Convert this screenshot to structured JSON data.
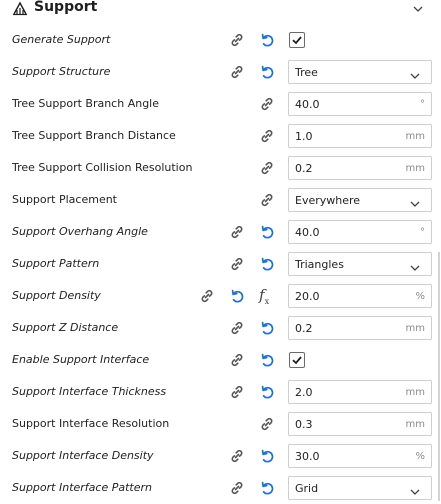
{
  "section": {
    "title": "Support",
    "icon": "support-section-icon",
    "collapse_icon": "chevron-down-icon"
  },
  "settings": [
    {
      "id": "generate-support",
      "label": "Generate Support",
      "italic": true,
      "link": "a",
      "reset": true,
      "control": "checkbox",
      "checked": true
    },
    {
      "id": "support-structure",
      "label": "Support Structure",
      "italic": true,
      "link": "a",
      "reset": true,
      "control": "select",
      "value": "Tree"
    },
    {
      "id": "tree-support-branch-angle",
      "label": "Tree Support Branch Angle",
      "italic": false,
      "link": "b",
      "reset": false,
      "control": "number",
      "value": "40.0",
      "unit": "°"
    },
    {
      "id": "tree-support-branch-distance",
      "label": "Tree Support Branch Distance",
      "italic": false,
      "link": "b",
      "reset": false,
      "control": "number",
      "value": "1.0",
      "unit": "mm"
    },
    {
      "id": "tree-support-collision-resolution",
      "label": "Tree Support Collision Resolution",
      "italic": false,
      "link": "b",
      "reset": false,
      "control": "number",
      "value": "0.2",
      "unit": "mm"
    },
    {
      "id": "support-placement",
      "label": "Support Placement",
      "italic": false,
      "link": "b",
      "reset": false,
      "control": "select",
      "value": "Everywhere"
    },
    {
      "id": "support-overhang-angle",
      "label": "Support Overhang Angle",
      "italic": true,
      "link": "a",
      "reset": true,
      "control": "number",
      "value": "40.0",
      "unit": "°"
    },
    {
      "id": "support-pattern",
      "label": "Support Pattern",
      "italic": true,
      "link": "a",
      "reset": true,
      "control": "select",
      "value": "Triangles"
    },
    {
      "id": "support-density",
      "label": "Support Density",
      "italic": true,
      "link": "c",
      "reset": true,
      "fx": true,
      "control": "number",
      "value": "20.0",
      "unit": "%"
    },
    {
      "id": "support-z-distance",
      "label": "Support Z Distance",
      "italic": true,
      "link": "a",
      "reset": true,
      "control": "number",
      "value": "0.2",
      "unit": "mm"
    },
    {
      "id": "enable-support-interface",
      "label": "Enable Support Interface",
      "italic": true,
      "link": "a",
      "reset": true,
      "control": "checkbox",
      "checked": true
    },
    {
      "id": "support-interface-thickness",
      "label": "Support Interface Thickness",
      "italic": true,
      "link": "a",
      "reset": true,
      "control": "number",
      "value": "2.0",
      "unit": "mm"
    },
    {
      "id": "support-interface-resolution",
      "label": "Support Interface Resolution",
      "italic": false,
      "link": "b",
      "reset": false,
      "control": "number",
      "value": "0.3",
      "unit": "mm"
    },
    {
      "id": "support-interface-density",
      "label": "Support Interface Density",
      "italic": true,
      "link": "a",
      "reset": true,
      "control": "number",
      "value": "30.0",
      "unit": "%"
    },
    {
      "id": "support-interface-pattern",
      "label": "Support Interface Pattern",
      "italic": true,
      "link": "a",
      "reset": true,
      "control": "select",
      "value": "Grid"
    }
  ],
  "colors": {
    "reset_icon": "#1f6fd6",
    "link_icon": "#555555",
    "field_border": "#cfcfcf",
    "unit_text": "#8a8a8a"
  }
}
